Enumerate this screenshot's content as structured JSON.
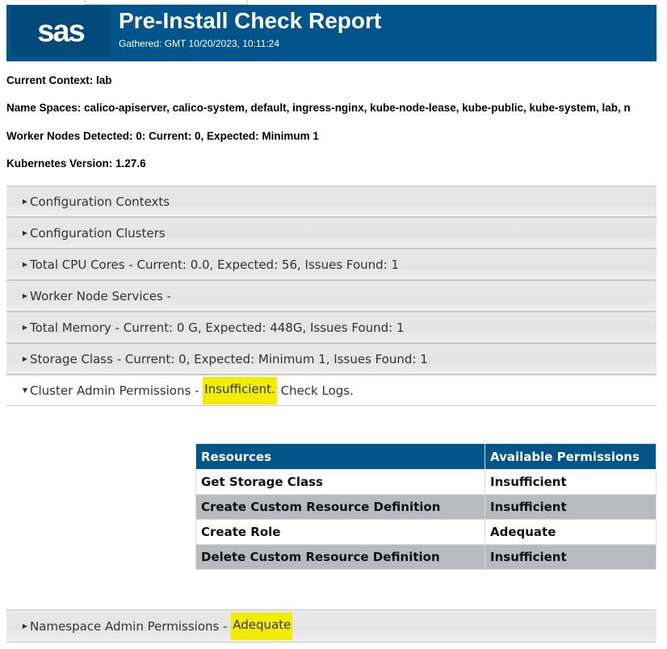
{
  "header": {
    "logo": "sas",
    "title": "Pre-Install Check Report",
    "gathered": "Gathered: GMT 10/20/2023, 10:11:24"
  },
  "info": {
    "context": "Current Context: lab",
    "namespaces": "Name Spaces: calico-apiserver, calico-system, default, ingress-nginx, kube-node-lease, kube-public, kube-system, lab, n",
    "worker_nodes": "Worker Nodes Detected: 0: Current: 0, Expected: Minimum 1",
    "k8s_version": "Kubernetes Version: 1.27.6"
  },
  "sections": [
    {
      "label": "Configuration Contexts"
    },
    {
      "label": "Configuration Clusters"
    },
    {
      "label": "Total CPU Cores - Current: 0.0, Expected: 56, Issues Found: 1"
    },
    {
      "label": "Worker Node Services -"
    },
    {
      "label": "Total Memory - Current: 0 G, Expected: 448G, Issues Found: 1"
    },
    {
      "label": "Storage Class - Current: 0, Expected: Minimum 1, Issues Found: 1"
    }
  ],
  "cluster_admin": {
    "label": "Cluster Admin Permissions - ",
    "status": "Insufficient.",
    "suffix": " Check Logs."
  },
  "permissions_table": {
    "headers": [
      "Resources",
      "Available Permissions"
    ],
    "rows": [
      [
        "Get Storage Class",
        "Insufficient"
      ],
      [
        "Create Custom Resource Definition",
        "Insufficient"
      ],
      [
        "Create Role",
        "Adequate"
      ],
      [
        "Delete Custom Resource Definition",
        "Insufficient"
      ]
    ]
  },
  "namespace_admin": {
    "label": "Namespace Admin Permissions - ",
    "status": "Adequate"
  },
  "colors": {
    "brand": "#02558a",
    "highlight": "#f2ec00"
  }
}
